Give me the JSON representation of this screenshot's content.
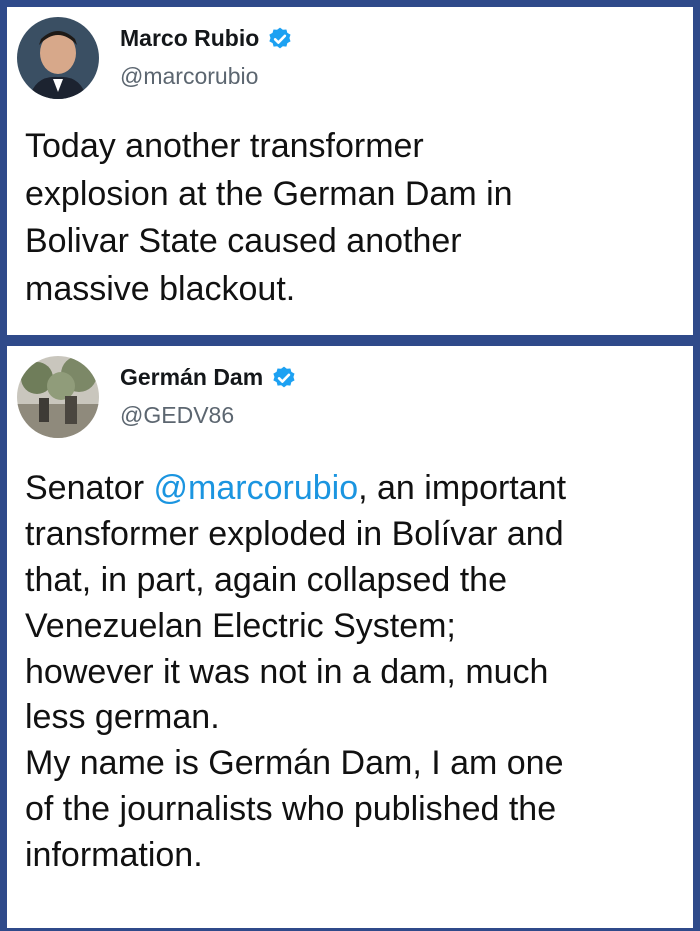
{
  "tweets": [
    {
      "name": "Marco Rubio",
      "handle": "@marcorubio",
      "verified": true,
      "text": "Today another transformer\nexplosion at the German Dam in\nBolivar State caused another\nmassive blackout."
    },
    {
      "name": "Germán Dam",
      "handle": "@GEDV86",
      "verified": true,
      "text_before_mention": "Senator ",
      "mention": "@marcorubio",
      "text_after_mention": ", an important\ntransformer exploded in Bolívar and\nthat, in part, again collapsed the\nVenezuelan Electric System;\nhowever it was not in a dam, much\nless german.\nMy name is Germán Dam, I am one\nof the journalists who published the\ninformation."
    }
  ],
  "colors": {
    "frame": "#2f4a8a",
    "verified_badge": "#1da1f2",
    "mention": "#1b95e0",
    "handle": "#5c6670"
  },
  "icons": [
    "verified-badge-icon",
    "avatar"
  ]
}
